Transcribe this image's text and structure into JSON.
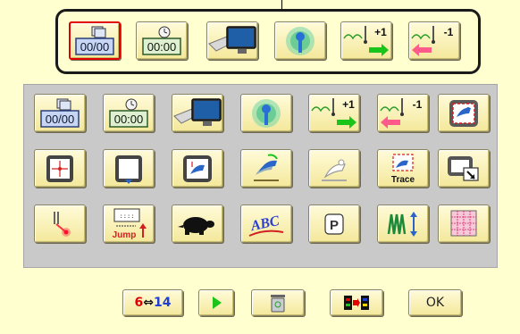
{
  "toolbar": {
    "frame_counter": "00/00",
    "timer": "00:00",
    "plus_one": "+1",
    "minus_one": "-1"
  },
  "grid": {
    "frame_counter": "00/00",
    "timer": "00:00",
    "plus_one": "+1",
    "minus_one": "-1",
    "trace_label": "Trace",
    "jump_label": "Jump",
    "abc_label": "ABC",
    "p_label": "P"
  },
  "bottom": {
    "swap_from": "6",
    "swap_arrow": "⇔",
    "swap_to": "14",
    "ok_label": "OK"
  },
  "colors": {
    "background": "#ffffcf",
    "panel": "#c9c9c9",
    "button": "#f4e89b",
    "selected_border": "#e00000",
    "swap_red": "#e00000",
    "swap_blue": "#2040d0",
    "arrow_green": "#1bc41b",
    "arrow_pink": "#ff5a8a"
  },
  "icons": [
    "frame-counter-icon",
    "timer-icon",
    "monitor-icon",
    "wireless-icon",
    "needle-forward-icon",
    "needle-back-icon",
    "embroidery-frame-icon",
    "frame-center-icon",
    "frame-bottom-icon",
    "frame-check-icon",
    "bird-rotate-icon",
    "bird-outline-icon",
    "trace-icon",
    "frame-move-icon",
    "needle-laser-icon",
    "jump-icon",
    "turtle-icon",
    "abc-icon",
    "p-icon",
    "zigzag-icon",
    "grid-icon",
    "play-icon",
    "trash-icon",
    "color-change-icon"
  ]
}
